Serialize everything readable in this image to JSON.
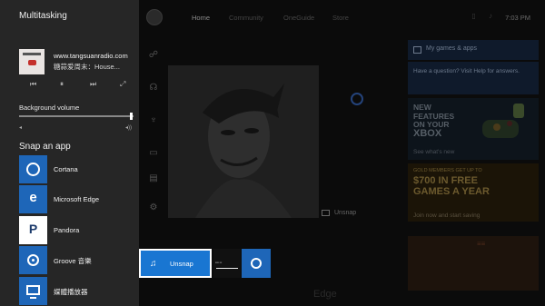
{
  "multitasking": {
    "title": "Multitasking",
    "now_playing": {
      "source": "www.tangsuanradio.com",
      "track": "糖蒜爱周末：House..."
    },
    "controls": {
      "prev": "⏮",
      "pause": "⏸",
      "next": "⏭",
      "expand": "⤢"
    },
    "volume": {
      "label": "Background volume",
      "level": 0.98,
      "low_icon": "◂",
      "high_icon": "◂))"
    },
    "snap_heading": "Snap an app",
    "apps": [
      {
        "label": "Cortana",
        "icon": "cortana-icon"
      },
      {
        "label": "Microsoft Edge",
        "icon": "edge-icon",
        "glyph": "e"
      },
      {
        "label": "Pandora",
        "icon": "pandora-icon",
        "glyph": "P"
      },
      {
        "label": "Groove 音樂",
        "icon": "groove-icon"
      },
      {
        "label": "媒體播放器",
        "icon": "media-player-icon"
      }
    ]
  },
  "snap_preview": {
    "unsnap_label": "Unsnap",
    "note_glyph": "♫"
  },
  "dashboard": {
    "tabs": [
      "Home",
      "Community",
      "OneGuide",
      "Store"
    ],
    "clock": "7:03 PM",
    "unsnap_label": "Unsnap",
    "tiles": {
      "my_games": "My games & apps",
      "help": "Have a question? Visit Help for answers.",
      "new_features": [
        "NEW",
        "FEATURES",
        "ON YOUR",
        "XBOX"
      ],
      "see_whats_new": "See what's new",
      "gold_small": "GOLD MEMBERS GET UP TO",
      "gold_big": [
        "$700 IN FREE",
        "GAMES A YEAR"
      ],
      "join": "Join now and start saving"
    },
    "bottom_text": "Edge"
  },
  "colors": {
    "panel_bg": "#262626",
    "accent": "#1976d2",
    "tile_blue": "#1e66b8"
  }
}
